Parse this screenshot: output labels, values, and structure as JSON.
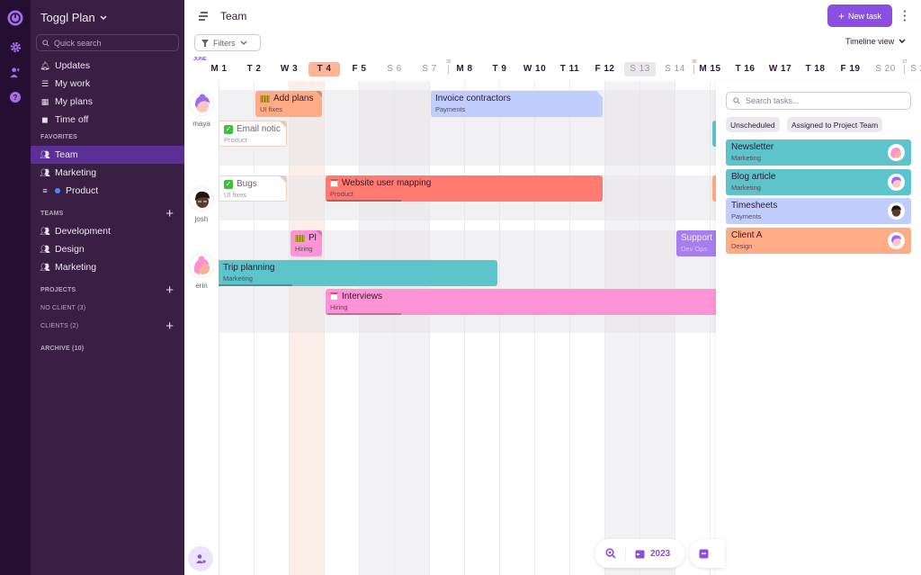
{
  "app": {
    "title": "Toggl Plan"
  },
  "rail": {
    "icons": [
      "toggl-logo-icon",
      "gear-icon",
      "team-icon",
      "help-icon"
    ]
  },
  "sidebar": {
    "search_placeholder": "Quick search",
    "nav": [
      {
        "label": "Updates",
        "icon": "bell-icon"
      },
      {
        "label": "My work",
        "icon": "list-icon"
      },
      {
        "label": "My plans",
        "icon": "plans-icon"
      },
      {
        "label": "Time off",
        "icon": "bag-icon"
      }
    ],
    "favorites_heading": "FAVORITES",
    "favorites": [
      {
        "label": "Team",
        "icon": "team-icon",
        "active": true
      },
      {
        "label": "Marketing",
        "icon": "team-icon"
      },
      {
        "label": "Product",
        "icon": "project-icon",
        "dot_color": "#4a8cff"
      }
    ],
    "teams_heading": "TEAMS",
    "teams": [
      {
        "label": "Development"
      },
      {
        "label": "Design"
      },
      {
        "label": "Marketing"
      }
    ],
    "projects_heading": "PROJECTS",
    "no_client": "NO CLIENT (3)",
    "clients": "CLIENTS (2)",
    "archive": "ARCHIVE (10)"
  },
  "header": {
    "title": "Team",
    "filters_label": "Filters",
    "new_task_label": "New task",
    "view_label": "Timeline view"
  },
  "timeline": {
    "month": "JUNE",
    "days": [
      {
        "label": "M 1",
        "weekend": false
      },
      {
        "label": "T 2",
        "weekend": false
      },
      {
        "label": "W 3",
        "weekend": false
      },
      {
        "label": "T 4",
        "weekend": false,
        "today": true
      },
      {
        "label": "F 5",
        "weekend": false
      },
      {
        "label": "S 6",
        "weekend": true
      },
      {
        "label": "S 7",
        "weekend": true
      },
      {
        "label": "M 8",
        "weekend": false,
        "week": "35"
      },
      {
        "label": "T 9",
        "weekend": false
      },
      {
        "label": "W 10",
        "weekend": false
      },
      {
        "label": "T 11",
        "weekend": false
      },
      {
        "label": "F 12",
        "weekend": false
      },
      {
        "label": "S 13",
        "weekend": true,
        "selected": true
      },
      {
        "label": "S 14",
        "weekend": true
      },
      {
        "label": "M 15",
        "weekend": false,
        "week": "36"
      },
      {
        "label": "T 16",
        "weekend": false
      },
      {
        "label": "W 17",
        "weekend": false
      },
      {
        "label": "T 18",
        "weekend": false
      },
      {
        "label": "F 19",
        "weekend": false
      },
      {
        "label": "S 20",
        "weekend": true
      },
      {
        "label": "S 21",
        "weekend": true,
        "week": "37"
      }
    ],
    "members": [
      {
        "name": "maya",
        "avatar_color": "#9b6bf0"
      },
      {
        "name": "josh",
        "avatar_color": "#3a2a24"
      },
      {
        "name": "erin",
        "avatar_color": "#ff8fd1"
      }
    ],
    "tasks": [
      {
        "title": "Add plans",
        "subtitle": "UI fixes",
        "color": "#ffab86",
        "icon": "fence-icon"
      },
      {
        "title": "Email notic",
        "subtitle": "Product",
        "style": "outline",
        "icon": "check-icon"
      },
      {
        "title": "Invoice contractors",
        "subtitle": "Payments",
        "color": "#c1cdfd"
      },
      {
        "title": "Bugs",
        "subtitle": "UI fixes",
        "style": "outline",
        "icon": "check-icon"
      },
      {
        "title": "Website user mapping",
        "subtitle": "Product",
        "color": "#ff7b72",
        "icon": "calendar-icon"
      },
      {
        "title": "Pl",
        "subtitle": "Hiring",
        "color": "#ff93d5",
        "icon": "fence-icon"
      },
      {
        "title": "Support",
        "subtitle": "Dev Ops",
        "color": "#a77ef0"
      },
      {
        "title": "Trip planning",
        "subtitle": "Marketing",
        "color": "#5ec4cc"
      },
      {
        "title": "Interviews",
        "subtitle": "Hiring",
        "color": "#ff93d5",
        "icon": "calendar-icon"
      }
    ]
  },
  "panel": {
    "search_placeholder": "Search tasks...",
    "chips": [
      "Unscheduled",
      "Assigned to Project Team"
    ],
    "tasks": [
      {
        "title": "Newsletter",
        "subtitle": "Marketing",
        "color": "#5ec4cc",
        "assignee": "erin"
      },
      {
        "title": "Blog article",
        "subtitle": "Marketing",
        "color": "#5ec4cc",
        "assignee": "maya"
      },
      {
        "title": "Timesheets",
        "subtitle": "Payments",
        "color": "#c1cdfd",
        "assignee": "josh"
      },
      {
        "title": "Client A",
        "subtitle": "Design",
        "color": "#ffab86",
        "assignee": "maya"
      }
    ]
  },
  "bottom": {
    "year": "2023"
  },
  "colors": {
    "accent": "#8a4ee0",
    "sidebar": "#3a1f44",
    "rail": "#240f33",
    "today": "#ffb595"
  }
}
